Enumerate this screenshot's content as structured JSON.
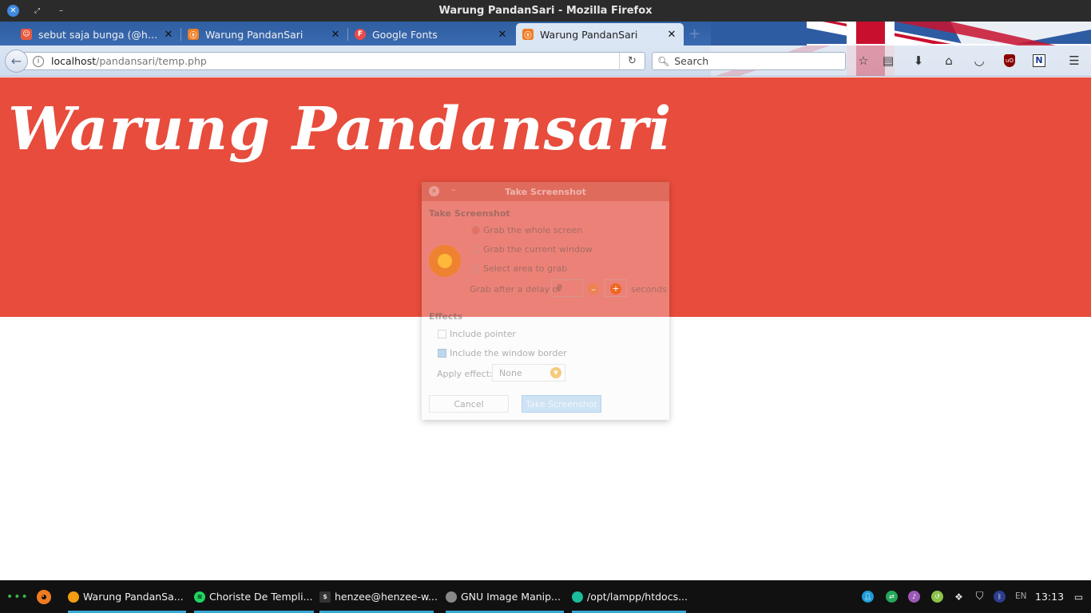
{
  "window": {
    "title": "Warung PandanSari - Mozilla Firefox"
  },
  "tabs": [
    {
      "label": "sebut saja bunga (@holly…",
      "favicon": "fox-icon",
      "active": false
    },
    {
      "label": "Warung PandanSari",
      "favicon": "xampp-icon",
      "active": false
    },
    {
      "label": "Google Fonts",
      "favicon": "google-fonts-icon",
      "active": false
    },
    {
      "label": "Warung PandanSari",
      "favicon": "xampp-icon",
      "active": true
    }
  ],
  "newtab_label": "+",
  "navbar": {
    "url_host": "localhost",
    "url_path": "/pandansari/temp.php",
    "search_placeholder": "Search"
  },
  "page": {
    "site_title": "Warung Pandansari",
    "hero_color": "#e74c3c"
  },
  "dialog": {
    "title": "Take Screenshot",
    "section_take": "Take Screenshot",
    "options": [
      "Grab the whole screen",
      "Grab the current window",
      "Select area to grab"
    ],
    "selected_option": 0,
    "delay_label": "Grab after a delay of",
    "delay_value": "0",
    "delay_unit": "seconds",
    "section_effects": "Effects",
    "include_pointer": "Include pointer",
    "include_border": "Include the window border",
    "apply_effect_label": "Apply effect:",
    "apply_effect_value": "None",
    "cancel": "Cancel",
    "take": "Take Screenshot"
  },
  "taskbar": {
    "items": [
      {
        "label": "Warung PandanSa...",
        "icon": "firefox-icon"
      },
      {
        "label": "Choriste De Templi...",
        "icon": "spotify-icon"
      },
      {
        "label": "henzee@henzee-w...",
        "icon": "terminal-icon"
      },
      {
        "label": "GNU Image Manip...",
        "icon": "gimp-icon"
      },
      {
        "label": "/opt/lampp/htdocs...",
        "icon": "folder-icon"
      }
    ],
    "lang": "EN",
    "clock": "13:13"
  }
}
